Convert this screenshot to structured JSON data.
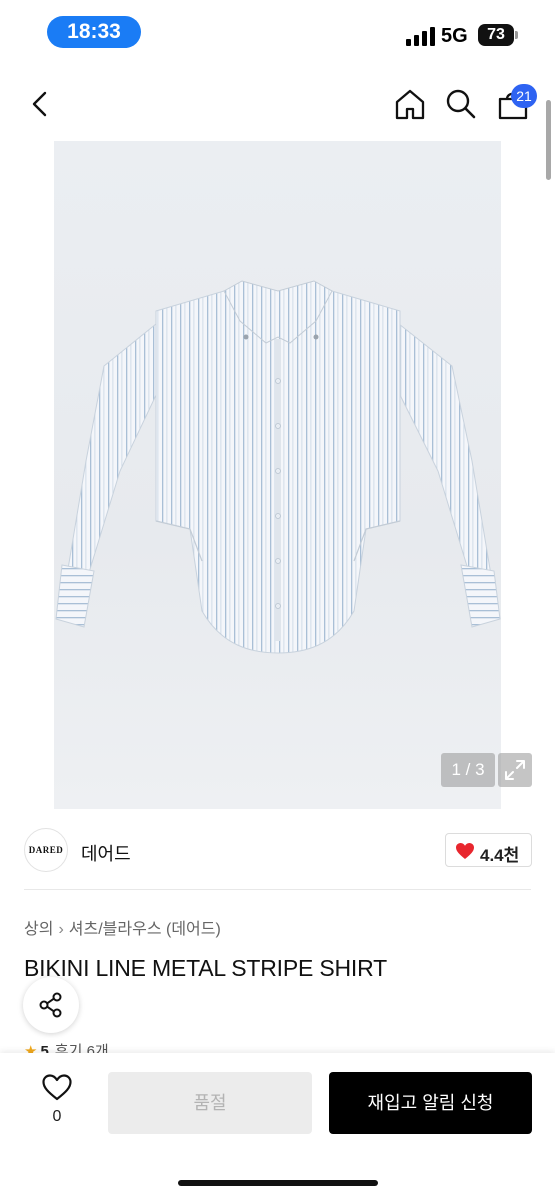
{
  "status_bar": {
    "time": "18:33",
    "network": "5G",
    "battery": "73"
  },
  "nav": {
    "cart_count": "21"
  },
  "image": {
    "counter": "1 / 3"
  },
  "brand": {
    "logo_text": "DARED",
    "name": "데어드",
    "likes": "4.4천"
  },
  "breadcrumb": {
    "category": "상의",
    "subcategory": "셔츠/블라우스 (데어드)"
  },
  "product": {
    "title": "BIKINI LINE METAL STRIPE SHIRT",
    "rating": "5",
    "reviews": "후기 6개"
  },
  "bottom_bar": {
    "wish_count": "0",
    "soldout_label": "품절",
    "restock_label": "재입고 알림 신청"
  },
  "colors": {
    "accent": "#2e63f2",
    "time_pill": "#1a7cf5",
    "heart": "#e8262e"
  }
}
